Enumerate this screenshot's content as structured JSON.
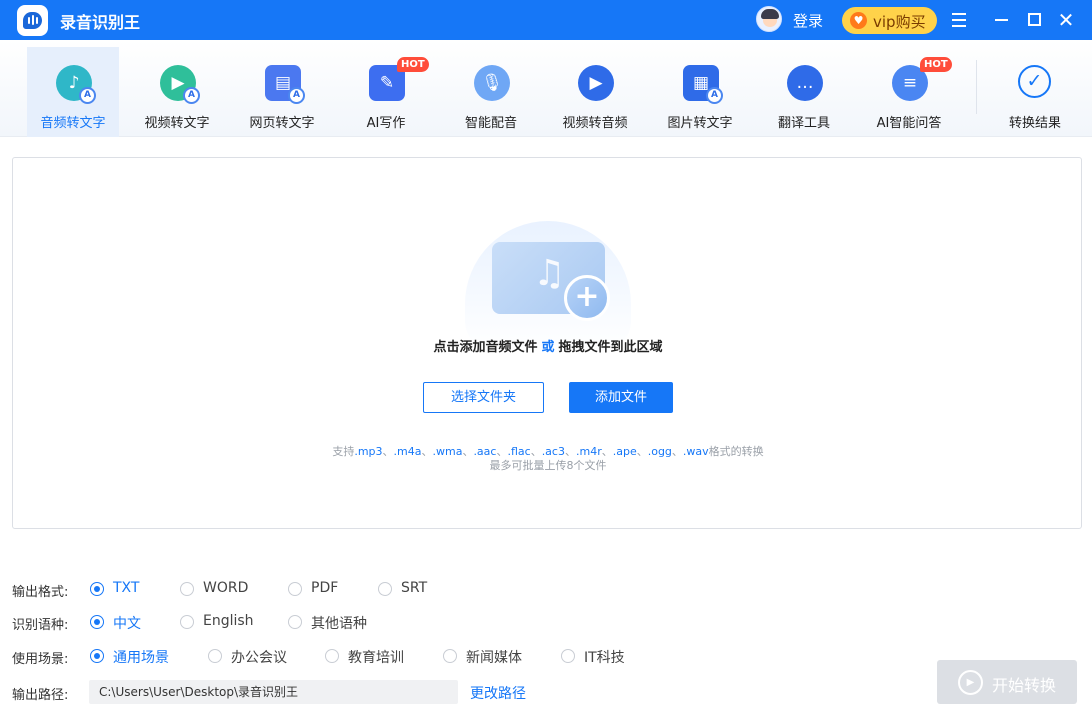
{
  "app": {
    "title": "录音识别王"
  },
  "header": {
    "login": "登录",
    "vip": "vip购买"
  },
  "toolbar": {
    "items": [
      {
        "label": "音频转文字",
        "icon": "audio-to-text-icon",
        "color": "#2fb7c8",
        "active": true,
        "hot": false
      },
      {
        "label": "视频转文字",
        "icon": "video-to-text-icon",
        "color": "#2fbf9a",
        "active": false,
        "hot": false
      },
      {
        "label": "网页转文字",
        "icon": "webpage-to-text-icon",
        "color": "#4b78f0",
        "active": false,
        "hot": false
      },
      {
        "label": "AI写作",
        "icon": "ai-writing-icon",
        "color": "#3d6ef0",
        "active": false,
        "hot": true
      },
      {
        "label": "智能配音",
        "icon": "microphone-icon",
        "color": "#6fa7f5",
        "active": false,
        "hot": false
      },
      {
        "label": "视频转音频",
        "icon": "video-to-audio-icon",
        "color": "#2f6be8",
        "active": false,
        "hot": false
      },
      {
        "label": "图片转文字",
        "icon": "image-to-text-icon",
        "color": "#2f6be8",
        "active": false,
        "hot": false
      },
      {
        "label": "翻译工具",
        "icon": "translate-icon",
        "color": "#2f6be8",
        "active": false,
        "hot": false
      },
      {
        "label": "AI智能问答",
        "icon": "ai-chat-icon",
        "color": "#4a86f2",
        "active": false,
        "hot": true
      }
    ],
    "hot_badge": "HOT",
    "result": {
      "label": "转换结果",
      "icon": "check-circle-icon"
    }
  },
  "dropzone": {
    "hint_a": "点击添加音频文件",
    "hint_or": "或",
    "hint_b": "拖拽文件到此区域",
    "btn_folder": "选择文件夹",
    "btn_add": "添加文件",
    "formats_prefix": "支持",
    "formats": [
      ".mp3",
      ".m4a",
      ".wma",
      ".aac",
      ".flac",
      ".ac3",
      ".m4r",
      ".ape",
      ".ogg",
      ".wav"
    ],
    "formats_sep": "、",
    "formats_suffix": "格式的转换",
    "limit": "最多可批量上传8个文件"
  },
  "options": {
    "format": {
      "label": "输出格式:",
      "choices": [
        "TXT",
        "WORD",
        "PDF",
        "SRT"
      ],
      "selected": 0
    },
    "language": {
      "label": "识别语种:",
      "choices": [
        "中文",
        "English",
        "其他语种"
      ],
      "selected": 0
    },
    "scene": {
      "label": "使用场景:",
      "choices": [
        "通用场景",
        "办公会议",
        "教育培训",
        "新闻媒体",
        "IT科技"
      ],
      "selected": 0
    },
    "path": {
      "label": "输出路径:",
      "value": "C:\\Users\\User\\Desktop\\录音识别王",
      "change": "更改路径"
    }
  },
  "start": {
    "label": "开始转换"
  },
  "colors": {
    "accent": "#1677f7",
    "hot": "#ff4d3a",
    "vip": "#ffd24a"
  }
}
